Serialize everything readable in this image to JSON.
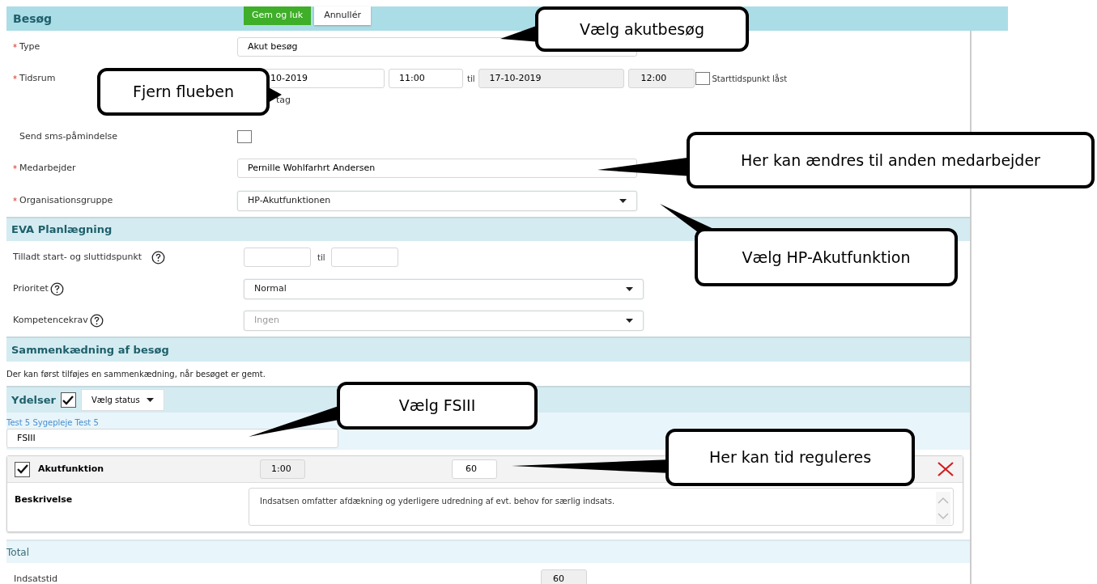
{
  "header": {
    "title": "Besøg",
    "buttons": [
      {
        "label": "Gem og luk",
        "kind": "primary"
      },
      {
        "label": "Annullér",
        "kind": "secondary"
      }
    ]
  },
  "fields": [
    {
      "kind": "text",
      "label": "Type",
      "required": "*",
      "value": "Akut besøg"
    },
    {
      "kind": "timerange",
      "label": "Tidsrum",
      "required": "*",
      "start_date": "10-2019",
      "start_time": "11:00",
      "separator": "til",
      "end_date": "17-10-2019",
      "end_time": "12:00",
      "lock": {
        "label": "Starttidspunkt låst",
        "checked": false
      },
      "note": "tag"
    },
    {
      "kind": "checkbox",
      "label": "Send sms-påmindelse",
      "checked": false
    },
    {
      "kind": "text",
      "label": "Medarbejder",
      "required": "*",
      "value": "Pernille Wohlfarhrt Andersen"
    },
    {
      "kind": "select",
      "label": "Organisationsgruppe",
      "required": "*",
      "value": "HP-Akutfunktionen"
    }
  ],
  "planning": {
    "title": "EVA Planlægning",
    "fields": [
      {
        "kind": "range",
        "label": "Tilladt start- og sluttidspunkt",
        "help": true,
        "separator": "til"
      },
      {
        "kind": "select",
        "label": "Prioritet",
        "help": true,
        "value": "Normal"
      },
      {
        "kind": "select",
        "label": "Kompetencekrav",
        "help": true,
        "placeholder": "Ingen"
      }
    ]
  },
  "linking": {
    "title": "Sammenkædning af besøg",
    "text": "Der kan først tilføjes en sammenkædning, når besøget er gemt."
  },
  "services": {
    "title": "Ydelser",
    "checked": true,
    "status_button": "Vælg status",
    "group": "Test 5 Sygepleje Test 5",
    "search": "FSIII",
    "items": [
      {
        "name": "Akutfunktion",
        "checked": true,
        "duration": "1:00",
        "minutes": "60",
        "description_label": "Beskrivelse",
        "description": "Indsatsen omfatter afdækning og yderligere udredning af evt. behov for særlig indsats."
      }
    ]
  },
  "total": {
    "title": "Total",
    "rows": [
      {
        "label": "Indsatstid",
        "value": "60"
      }
    ]
  },
  "callouts": [
    {
      "text": "Vælg akutbesøg"
    },
    {
      "text": "Fjern flueben"
    },
    {
      "text": "Her kan ændres til anden medarbejder"
    },
    {
      "text": "Vælg HP-Akutfunktion"
    },
    {
      "text": "Vælg FSIII"
    },
    {
      "text": "Her kan tid reguleres"
    }
  ]
}
